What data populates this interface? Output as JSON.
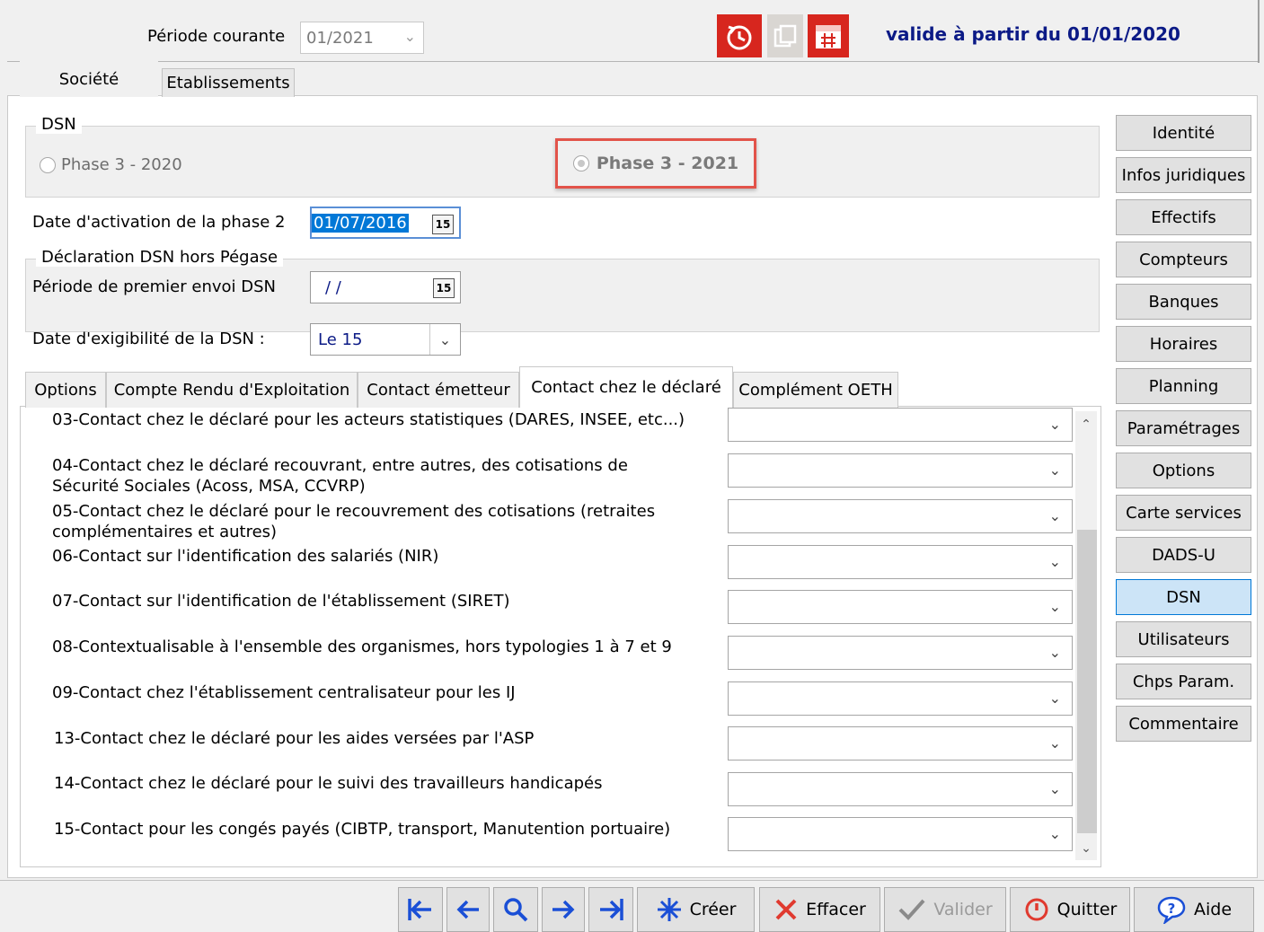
{
  "header": {
    "period_label": "Période courante",
    "period_value": "01/2021",
    "valid_text": "valide à partir du 01/01/2020",
    "icons": [
      "history-clock-icon",
      "copy-pages-icon",
      "calendar-icon"
    ],
    "icon_colors": {
      "red": "#d7261e",
      "gray": "#d9d6d2"
    },
    "valid_text_color": "#0b1a86"
  },
  "main_tabs": [
    {
      "label": "Société",
      "active": true
    },
    {
      "label": "Etablissements",
      "active": false
    }
  ],
  "dsn": {
    "group_title": "DSN",
    "phase_2020": "Phase 3 - 2020",
    "phase_2021": "Phase 3 - 2021",
    "highlight_color": "#e2534a"
  },
  "form": {
    "activation_label": "Date d'activation de la phase 2",
    "activation_value": "01/07/2016",
    "hors_pegase_title": "Déclaration DSN hors Pégase",
    "premier_envoi_label": "Période de premier envoi DSN",
    "premier_envoi_value": "/ /",
    "exigibilite_label": "Date d'exigibilité de la DSN :",
    "exigibilite_value": "Le 15"
  },
  "sub_tabs": [
    {
      "label": "Options"
    },
    {
      "label": "Compte Rendu d'Exploitation"
    },
    {
      "label": "Contact émetteur"
    },
    {
      "label": "Contact chez le déclaré",
      "active": true
    },
    {
      "label": "Complément OETH"
    }
  ],
  "contacts": [
    {
      "label": "03-Contact chez le déclaré pour les acteurs statistiques (DARES, INSEE, etc...)",
      "value": ""
    },
    {
      "label": "04-Contact chez le déclaré recouvrant, entre autres, des cotisations de Sécurité Sociales (Acoss, MSA, CCVRP)",
      "value": ""
    },
    {
      "label": "05-Contact chez le déclaré pour le recouvrement des cotisations (retraites complémentaires et autres)",
      "value": ""
    },
    {
      "label": "06-Contact sur l'identification des salariés (NIR)",
      "value": ""
    },
    {
      "label": "07-Contact sur l'identification de l'établissement (SIRET)",
      "value": ""
    },
    {
      "label": "08-Contextualisable à l'ensemble des organismes, hors typologies 1 à 7 et 9",
      "value": ""
    },
    {
      "label": "09-Contact chez l'établissement centralisateur pour les IJ",
      "value": ""
    },
    {
      "label": "13-Contact chez le déclaré pour les aides versées par l'ASP",
      "value": ""
    },
    {
      "label": "14-Contact chez le déclaré pour le suivi des travailleurs handicapés",
      "value": ""
    },
    {
      "label": "15-Contact pour les congés payés (CIBTP, transport, Manutention portuaire)",
      "value": ""
    }
  ],
  "side_buttons": [
    {
      "label": "Identité"
    },
    {
      "label": "Infos juridiques"
    },
    {
      "label": "Effectifs"
    },
    {
      "label": "Compteurs"
    },
    {
      "label": "Banques"
    },
    {
      "label": "Horaires"
    },
    {
      "label": "Planning"
    },
    {
      "label": "Paramétrages"
    },
    {
      "label": "Options"
    },
    {
      "label": "Carte services"
    },
    {
      "label": "DADS-U"
    },
    {
      "label": "DSN",
      "active": true
    },
    {
      "label": "Utilisateurs"
    },
    {
      "label": "Chps Param."
    },
    {
      "label": "Commentaire"
    }
  ],
  "bottom": {
    "nav": [
      "first-record-icon",
      "previous-record-icon",
      "search-icon",
      "next-record-icon",
      "last-record-icon"
    ],
    "creer": "Créer",
    "effacer": "Effacer",
    "valider": "Valider",
    "quitter": "Quitter",
    "aide": "Aide"
  }
}
